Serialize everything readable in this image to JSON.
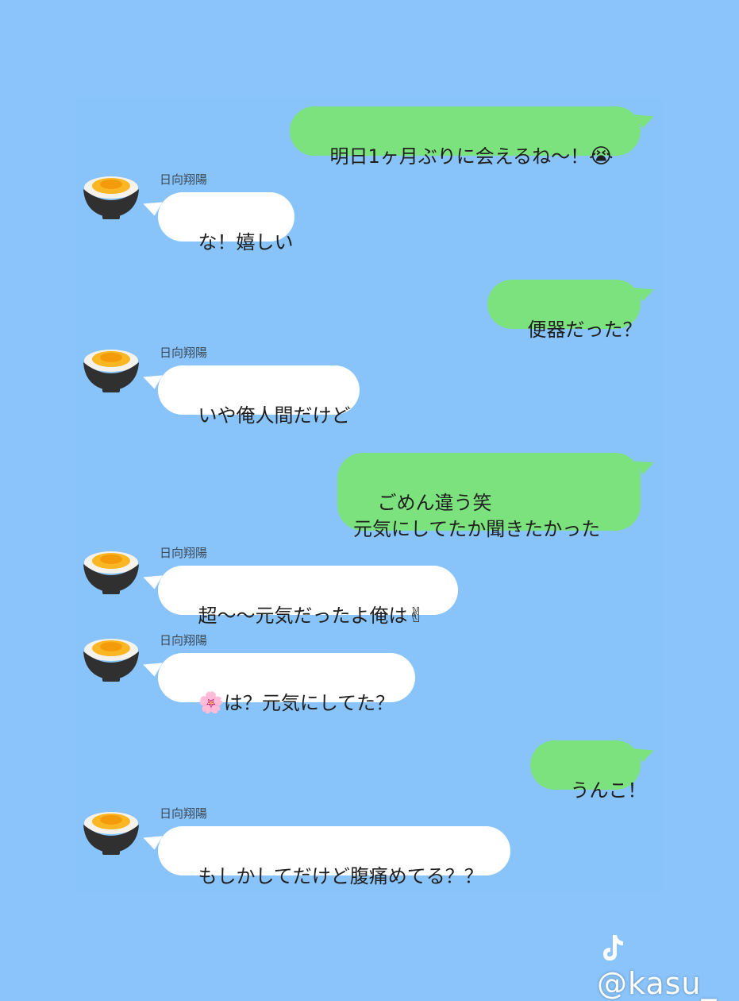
{
  "messages": [
    {
      "from": "me",
      "text": "明日1ヶ月ぶりに会えるね〜！",
      "emoji": "😭"
    },
    {
      "from": "them",
      "name": "日向翔陽",
      "text": "な！嬉しい"
    },
    {
      "from": "me",
      "text": "便器だった？"
    },
    {
      "from": "them",
      "name": "日向翔陽",
      "text": "いや俺人間だけど"
    },
    {
      "from": "me",
      "text": "ごめん違う笑\n元気にしてたか聞きたかった"
    },
    {
      "from": "them",
      "name": "日向翔陽",
      "text": "超〜〜元気だったよ俺は",
      "emoji": "✌"
    },
    {
      "from": "them",
      "name": "日向翔陽",
      "text": "は？元気にしてた？",
      "emoji_prefix": "🌸"
    },
    {
      "from": "me",
      "text": "うんこ！"
    },
    {
      "from": "them",
      "name": "日向翔陽",
      "text": "もしかしてだけど腹痛めてる？？"
    }
  ],
  "avatar_icon": "tamago-kake-gohan-bowl-icon",
  "watermark": {
    "icon": "tiktok-logo-icon",
    "text": "@kasu_"
  },
  "colors": {
    "background": "#8ac4fb",
    "sent_bubble": "#7be27d",
    "received_bubble": "#ffffff"
  }
}
